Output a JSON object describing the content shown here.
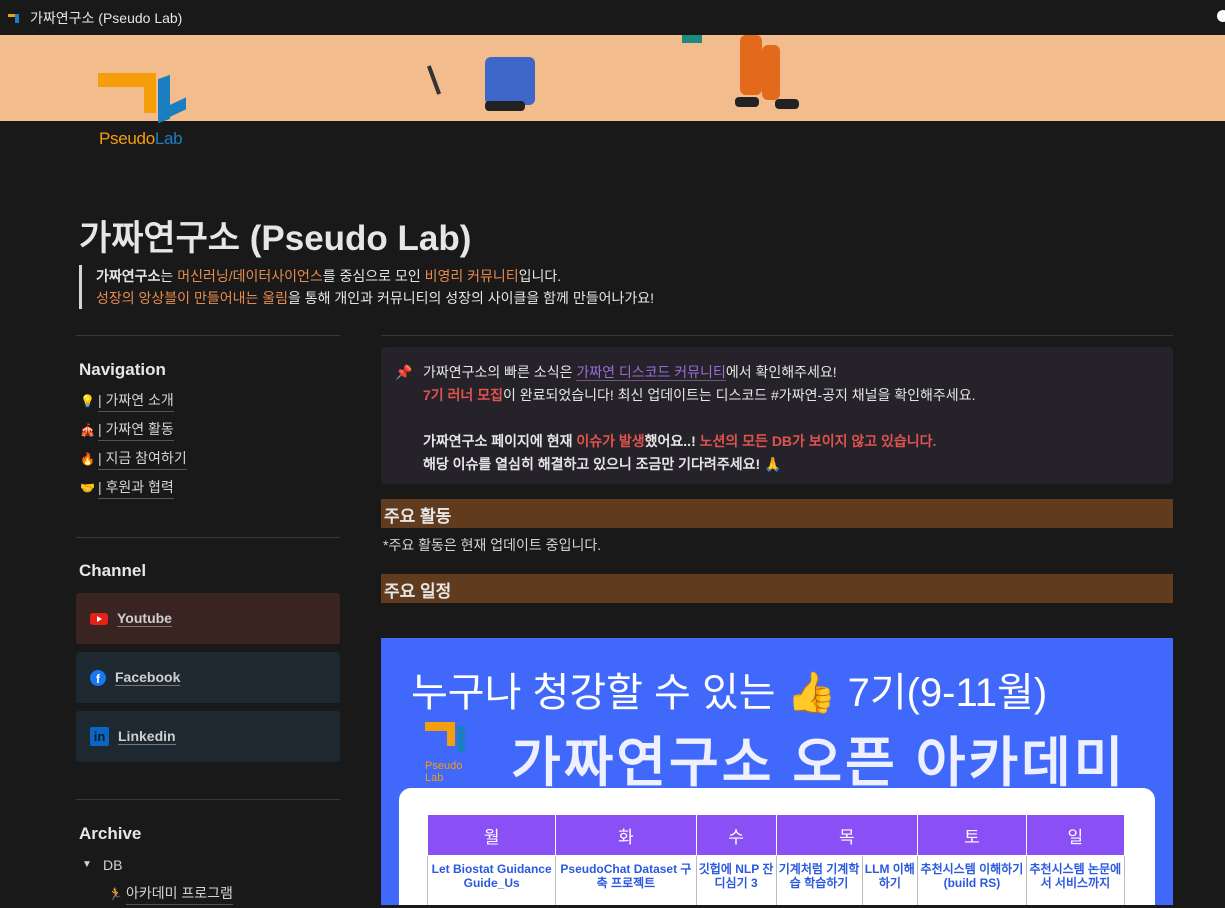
{
  "tab": {
    "title": "가짜연구소 (Pseudo Lab)"
  },
  "logo": {
    "text_a": "Pseudo",
    "text_b": "Lab"
  },
  "page": {
    "title": "가짜연구소 (Pseudo Lab)",
    "intro": {
      "a": "가짜연구소",
      "b": "는 ",
      "c": "머신러닝/데이터사이언스",
      "d": "를 중심으로 모인 ",
      "e": "비영리 커뮤니티",
      "f": "입니다.",
      "g": "성장의 앙상블이 만들어내는 울림",
      "h": "을 통해 개인과 커뮤니티의 성장의 사이클을 함께 만들어나가요!"
    }
  },
  "sidebar": {
    "navigation": {
      "title": "Navigation",
      "items": [
        {
          "icon": "lightbulb-icon",
          "glyph": "💡",
          "label": "| 가짜연 소개"
        },
        {
          "icon": "circus-tent-icon",
          "glyph": "🎪",
          "label": "| 가짜연 활동"
        },
        {
          "icon": "fire-icon",
          "glyph": "🔥",
          "label": "| 지금 참여하기"
        },
        {
          "icon": "handshake-icon",
          "glyph": "🤝",
          "label": "| 후원과 협력"
        }
      ]
    },
    "channel": {
      "title": "Channel",
      "items": [
        {
          "label": "Youtube",
          "bg": "#3a2422"
        },
        {
          "label": "Facebook",
          "bg": "#1d2830"
        },
        {
          "label": "Linkedin",
          "bg": "#1d2830"
        }
      ]
    },
    "archive": {
      "title": "Archive",
      "db": "DB",
      "item": "아카데미 프로그램",
      "item_glyph": "🏃"
    }
  },
  "callout": {
    "l1a": "가짜연구소의 빠른 소식은 ",
    "l1b": "가짜연 디스코드 커뮤니티",
    "l1c": "에서 확인해주세요!",
    "l2a": "7기 러너 모집",
    "l2b": "이 완료되었습니다! 최신 업데이트는 디스코드 #가짜연-공지 채널을 확인해주세요.",
    "l3a": "가짜연구소 페이지에 현재 ",
    "l3b": "이슈가 발생",
    "l3c": "했어요..! ",
    "l3d": "노션의 모든 DB가 보이지 않고 있습니다.",
    "l4": "해당 이슈를 열심히 해결하고 있으니 조금만 기다려주세요! 🙏"
  },
  "sections": {
    "activities": "주요 활동",
    "activities_note": "*주요 활동은 현재 업데이트 중입니다.",
    "schedule": "주요 일정"
  },
  "poster": {
    "line1": "누구나 청강할 수 있는 👍 7기(9-11월)",
    "line2": "가짜연구소 오픈 아카데미",
    "logo_text": "Pseudo Lab",
    "days": [
      "월",
      "화",
      "수",
      "목",
      "토",
      "일"
    ],
    "cells": [
      "Let Biostat Guidance Guide_Us",
      "PseudoChat Dataset 구축 프로젝트",
      "깃헙에 NLP 잔디심기 3",
      "기계처럼 기계학습 학습하기",
      "LLM 이해하기",
      "추천시스템 이해하기 (build RS)",
      "추천시스템 논문에서 서비스까지"
    ]
  },
  "colors": {
    "accent_orange": "#e98b4f",
    "heading_bg": "#603b1d",
    "poster_bg": "#4069fb",
    "table_header": "#8a50f5"
  }
}
